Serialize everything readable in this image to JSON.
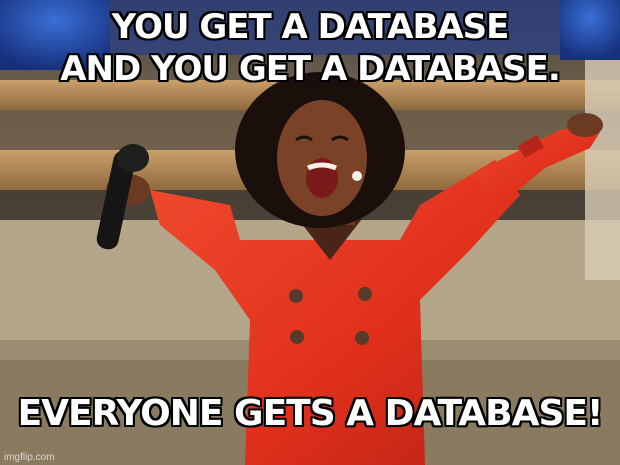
{
  "meme": {
    "top_text": {
      "line1": "YOU GET A DATABASE",
      "line2": "AND YOU GET A DATABASE."
    },
    "bottom_text": "EVERYONE GETS A DATABASE!",
    "watermark": "imgflip.com"
  },
  "colors": {
    "caption_fill": "#ffffff",
    "caption_stroke": "#000000",
    "dress_red": "#e8301e",
    "stage_wood": "#b58a55"
  }
}
